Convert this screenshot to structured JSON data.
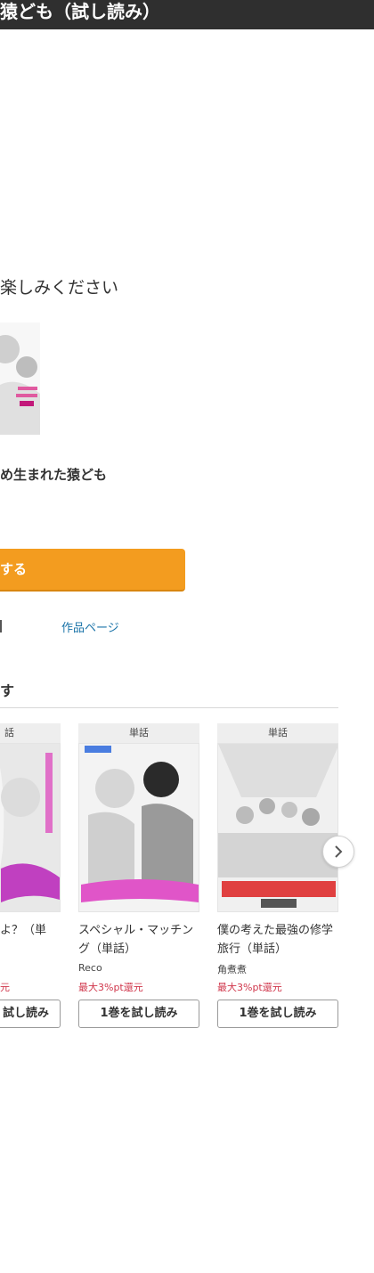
{
  "header": {
    "title": "猿ども（試し読み）"
  },
  "intro": {
    "enjoy_text": "楽しみください"
  },
  "book": {
    "title": "め生まれた猿ども",
    "cta_label": "する",
    "work_page_link": "作品ページ"
  },
  "recommend": {
    "heading": "す",
    "cards": [
      {
        "tag": "話",
        "title": "よ？（単",
        "author": "",
        "points": "元",
        "button": "試し読み"
      },
      {
        "tag": "単話",
        "title": "スペシャル・マッチング（単話）",
        "author": "Reco",
        "points": "最大3%pt還元",
        "button": "1巻を試し読み"
      },
      {
        "tag": "単話",
        "title": "僕の考えた最強の修学旅行（単話）",
        "author": "角煮煮",
        "points": "最大3%pt還元",
        "button": "1巻を試し読み"
      }
    ],
    "next_icon": "chevron-right-icon"
  },
  "colors": {
    "header_bg": "#2f2f2f",
    "cta_orange": "#f39c1f",
    "link_blue": "#1a73a8",
    "points_red": "#d0364b"
  }
}
